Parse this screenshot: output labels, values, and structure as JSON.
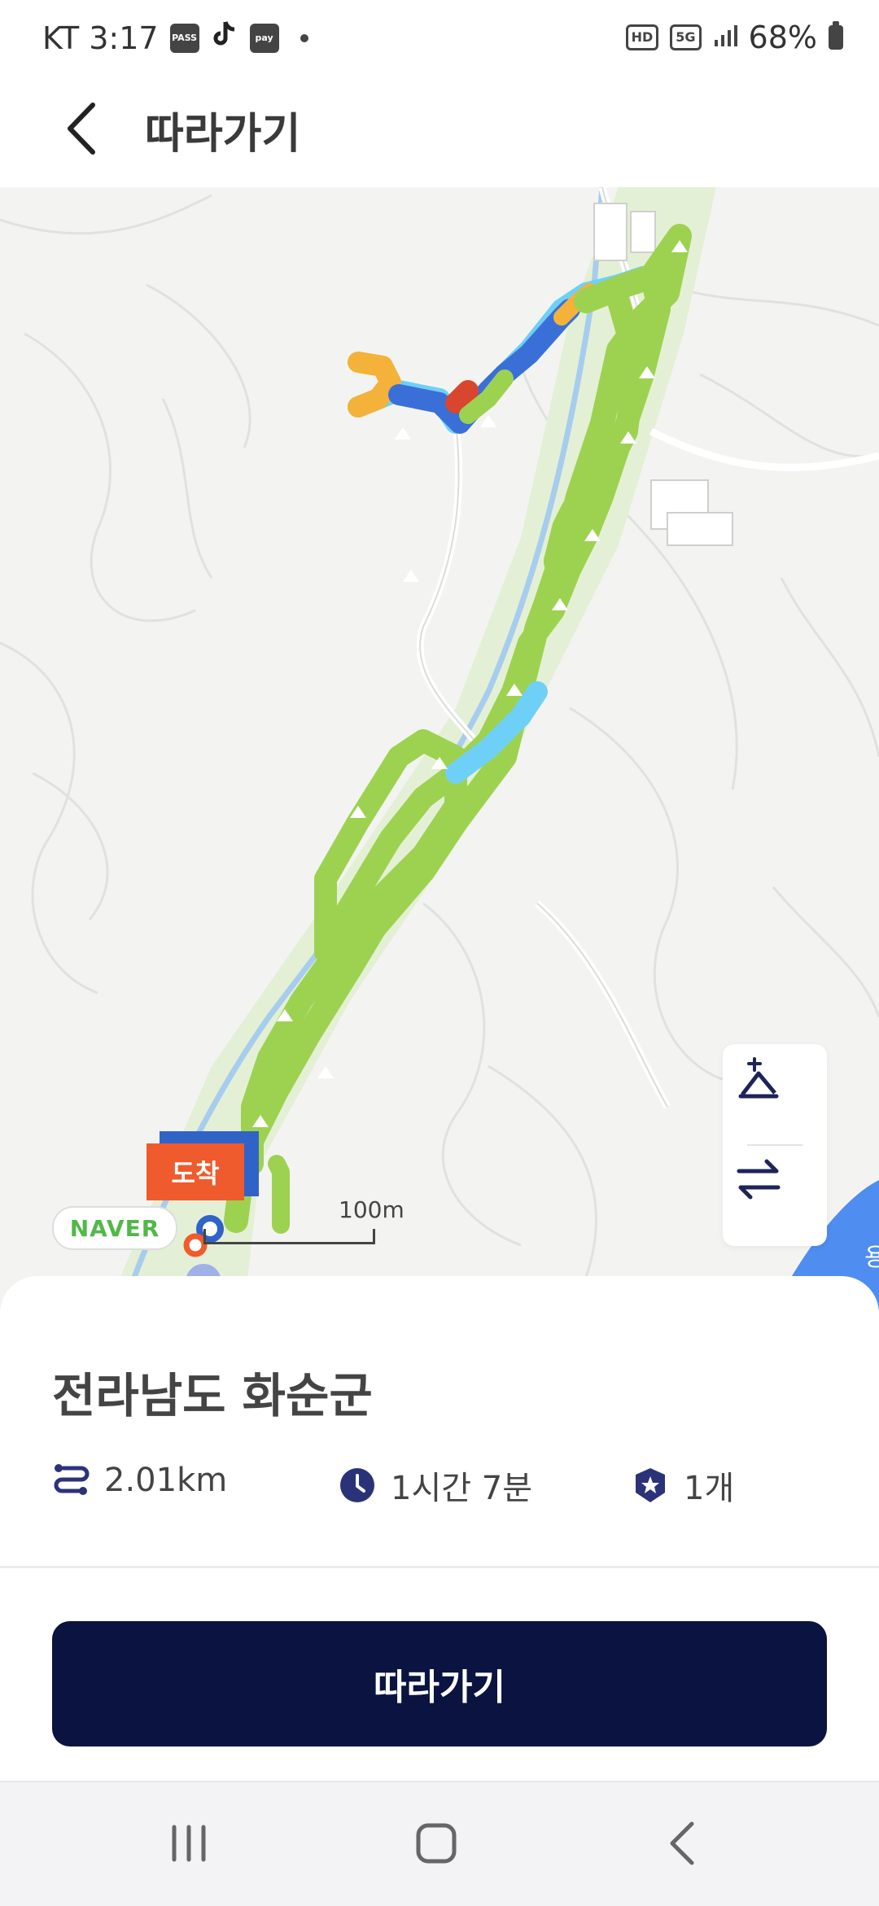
{
  "status_bar": {
    "carrier_time": "KT 3:17",
    "app_icons": [
      "pass-icon",
      "tiktok-icon",
      "pay-icon"
    ],
    "pass_label": "PASS",
    "pay_label": "pay",
    "hd_label": "HD",
    "network_label": "5G",
    "battery_percent": "68%"
  },
  "header": {
    "title": "따라가기",
    "back_icon": "chevron-left-icon"
  },
  "map": {
    "arrival_label": "도착",
    "naver_label": "NAVER",
    "scale_label": "100m",
    "right_edge_label": "용",
    "controls": [
      "elevation-chart-icon",
      "swap-direction-icon"
    ],
    "colors": {
      "route_green": "#9dd250",
      "route_blue": "#3a6fd8",
      "route_lightblue": "#6fd0f7",
      "route_orange": "#f4b23a",
      "route_red": "#d8462e",
      "water": "#4f8df0"
    }
  },
  "summary": {
    "region": "전라남도 화순군",
    "distance": "2.01km",
    "duration": "1시간 7분",
    "badge_count": "1개",
    "icons": [
      "route-distance-icon",
      "clock-icon",
      "badge-star-icon"
    ]
  },
  "actions": {
    "follow_label": "따라가기"
  },
  "navbar": {
    "items": [
      "recent-apps-icon",
      "home-icon",
      "back-icon"
    ]
  }
}
